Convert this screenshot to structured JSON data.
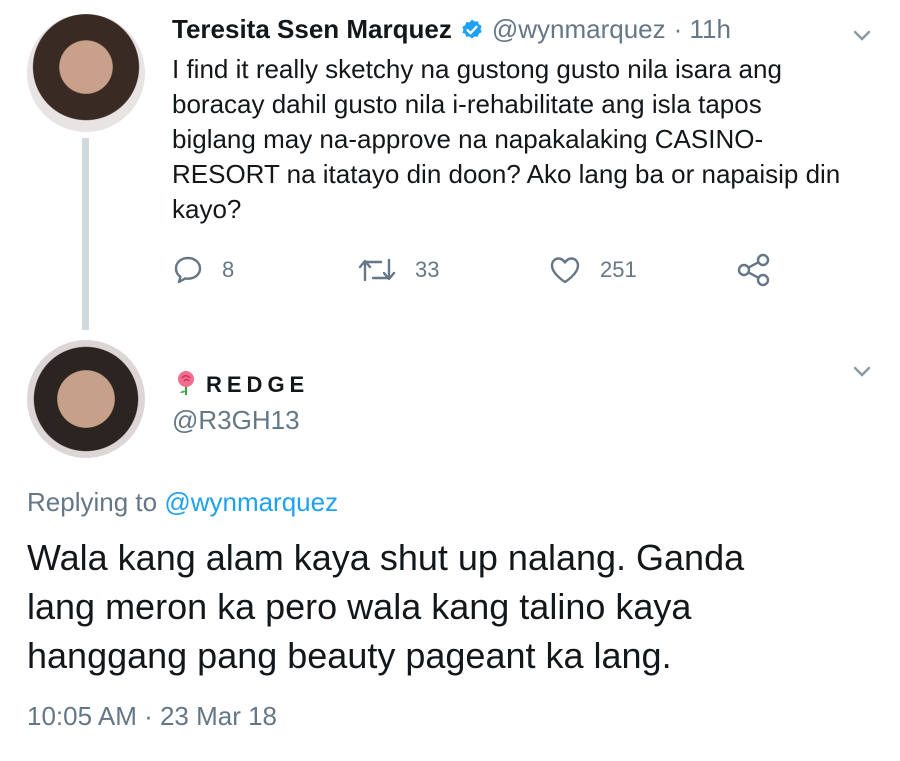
{
  "parent_tweet": {
    "display_name": "Teresita Ssen Marquez",
    "handle": "@wynmarquez",
    "time": "· 11h",
    "text_lines": [
      "I find it really sketchy na gustong gusto nila isara ang",
      "boracay dahil gusto nila i-rehabilitate ang isla tapos",
      "biglang may na-approve na napakalaking CASINO-",
      "RESORT na itatayo din doon? Ako lang ba or napaisip din",
      "kayo?"
    ],
    "actions": {
      "replies": "8",
      "retweets": "33",
      "likes": "251"
    },
    "verified": true,
    "icons": [
      "verified-badge-icon",
      "chevron-down-icon",
      "reply-icon",
      "retweet-icon",
      "like-icon",
      "share-icon"
    ]
  },
  "reply_tweet": {
    "display_name": "REDGE",
    "handle": "@R3GH13",
    "replying_prefix": "Replying to",
    "replying_mention": "@wynmarquez",
    "text_lines": [
      "Wala kang alam kaya shut up nalang. Ganda",
      "lang meron ka pero wala kang talino kaya",
      "hanggang pang beauty pageant ka lang."
    ],
    "timestamp": "10:05 AM · 23 Mar 18",
    "icons": [
      "rose-emoji-icon",
      "chevron-down-icon"
    ]
  },
  "colors": {
    "text": "#14171a",
    "secondary": "#657786",
    "accent": "#1da1f2",
    "thread_line": "#cfd9de"
  }
}
